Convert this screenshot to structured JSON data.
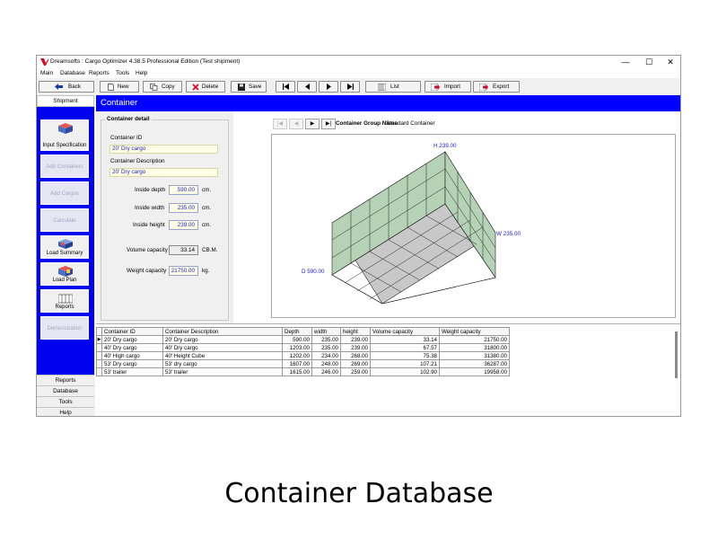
{
  "window": {
    "title": "Dreamsofts : Cargo Optimizer 4.38.5 Professional Edition  (Test shipment)",
    "controls": {
      "minimize": "—",
      "maximize": "☐",
      "close": "✕"
    }
  },
  "menu": {
    "items": [
      "Main",
      "Database",
      "Reports",
      "Tools",
      "Help"
    ]
  },
  "toolbar": {
    "back": "Back",
    "new": "New",
    "copy": "Copy",
    "delete": "Delete",
    "save": "Save",
    "list": "List",
    "import": "Import",
    "export": "Export"
  },
  "sidebar": {
    "tab_head": "Shipment",
    "buttons": [
      {
        "label": "Input Specification",
        "icon": "box-icon",
        "enabled": true
      },
      {
        "label": "Add Containers",
        "enabled": false
      },
      {
        "label": "Add Cargos",
        "enabled": false
      },
      {
        "label": "Calculate",
        "enabled": false
      },
      {
        "label": "Load Summary",
        "icon": "truck-icon",
        "enabled": true
      },
      {
        "label": "Load Plan",
        "icon": "boxes-icon",
        "enabled": true
      },
      {
        "label": "Reports",
        "icon": "reports-icon",
        "enabled": true
      },
      {
        "label": "Demonstration",
        "enabled": false
      }
    ],
    "bottom_tabs": [
      "Reports",
      "Database",
      "Tools",
      "Help"
    ]
  },
  "main": {
    "header": "Container",
    "detail": {
      "group_title": "Container detail",
      "id_label": "Container ID",
      "id_value": "20' Dry cargo",
      "desc_label": "Container Description",
      "desc_value": "20' Dry cargo",
      "depth_label": "Inside depth",
      "depth_value": "590.00",
      "width_label": "Inside width",
      "width_value": "235.00",
      "height_label": "Inside height",
      "height_value": "239.00",
      "dim_unit": "cm.",
      "volume_label": "Volume capacity",
      "volume_value": "33.14",
      "volume_unit": "CB.M.",
      "weight_label": "Weight capacity",
      "weight_value": "21750.00",
      "weight_unit": "kg."
    },
    "nav": {
      "first": "|◀",
      "prev": "◀",
      "next": "▶",
      "last": "▶|"
    },
    "group_name_label": "Container Group Name",
    "group_name_value": "Standard Container",
    "viewer": {
      "h_label": "H 239.00",
      "w_label": "W 235.00",
      "d_label": "D 590.00"
    }
  },
  "grid": {
    "columns": [
      "Container ID",
      "Container Description",
      "Depth",
      "width",
      "height",
      "Volume capacity",
      "Weight capacity"
    ],
    "rows": [
      [
        "20' Dry cargo",
        "20' Dry cargo",
        "590.00",
        "235.00",
        "239.00",
        "33.14",
        "21750.00"
      ],
      [
        "40' Dry cargo",
        "40' Dry cargo",
        "1203.00",
        "235.00",
        "239.00",
        "67.57",
        "31800.00"
      ],
      [
        "40' High cargo",
        "40' Height Cube",
        "1202.00",
        "234.00",
        "268.00",
        "75.38",
        "31380.00"
      ],
      [
        "53' Dry cargo",
        "53' dry cargo",
        "1607.00",
        "248.00",
        "269.00",
        "107.21",
        "36287.00"
      ],
      [
        "53' trailer",
        "53' trailer",
        "1615.00",
        "246.00",
        "259.00",
        "102.90",
        "19958.00"
      ]
    ],
    "selected_row_marker": "▶"
  },
  "caption": "Container Database",
  "colors": {
    "header_blue": "#0000ff",
    "sidebar_blue": "#0000ee",
    "container_face": "#b6d2b6"
  }
}
